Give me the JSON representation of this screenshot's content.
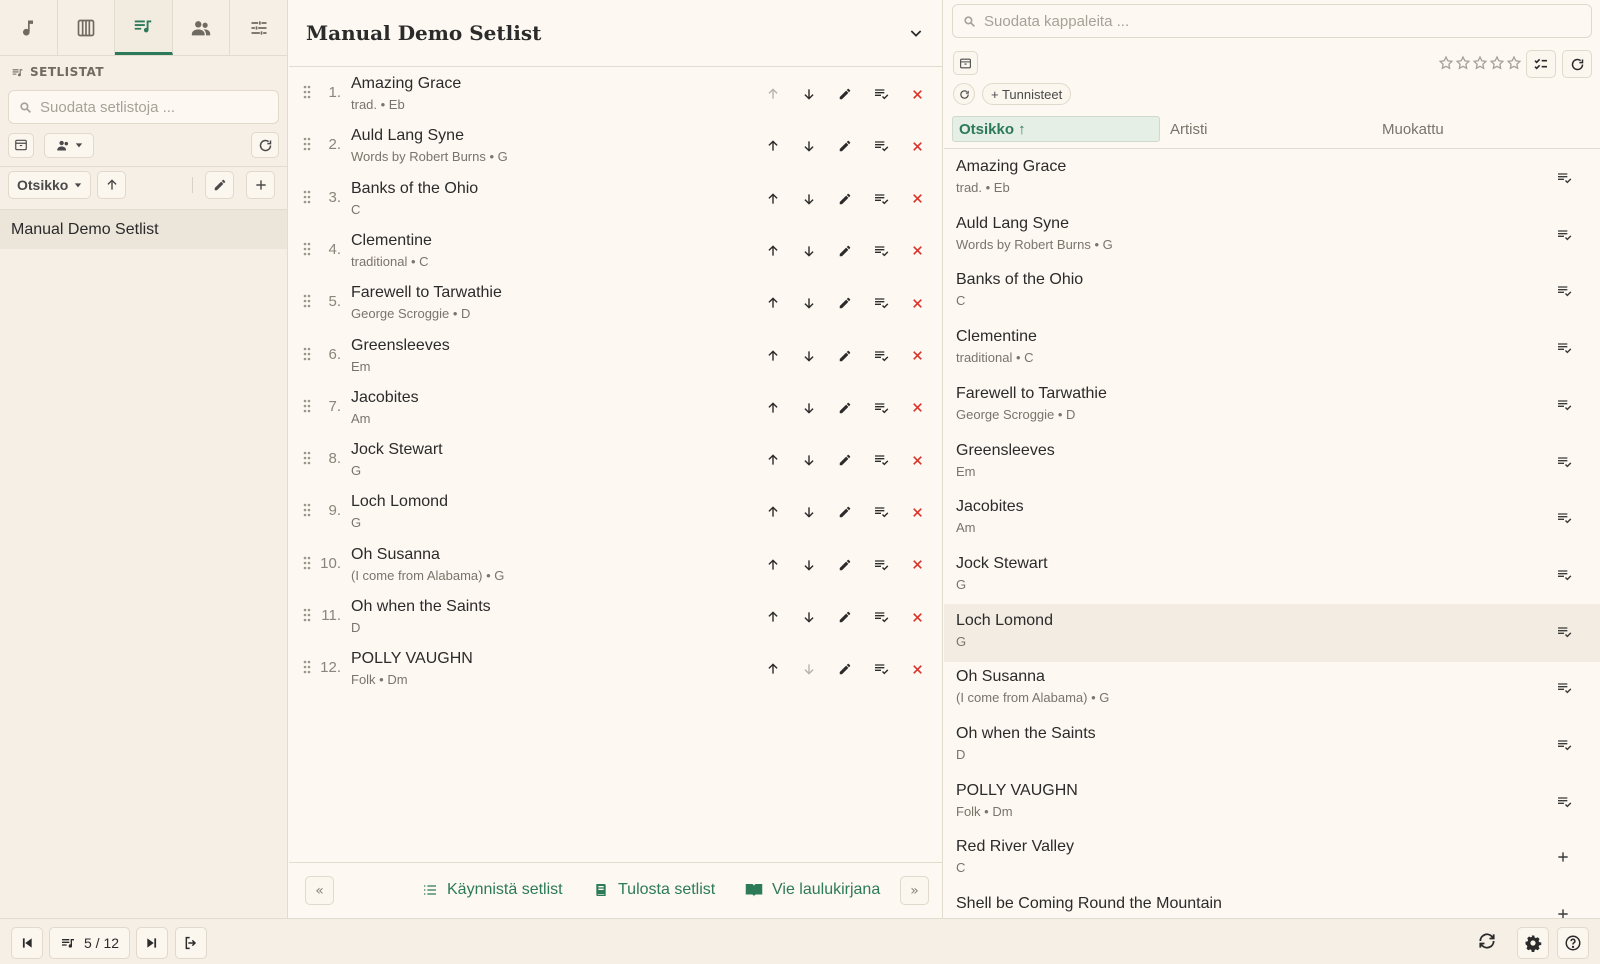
{
  "left": {
    "tabs": [
      "music-note-icon",
      "piano-icon",
      "playlist-icon",
      "people-icon",
      "sliders-icon"
    ],
    "section_title": "SETLISTAT",
    "filter_placeholder": "Suodata setlistoja ...",
    "sort_label": "Otsikko",
    "setlists": [
      "Manual Demo Setlist"
    ]
  },
  "middle": {
    "title": "Manual Demo Setlist",
    "songs": [
      {
        "n": "1.",
        "title": "Amazing Grace",
        "sub": "trad. • Eb",
        "up_disabled": true,
        "down_disabled": false
      },
      {
        "n": "2.",
        "title": "Auld Lang Syne",
        "sub": "Words by Robert Burns • G",
        "up_disabled": false,
        "down_disabled": false
      },
      {
        "n": "3.",
        "title": "Banks of the Ohio",
        "sub": "C",
        "up_disabled": false,
        "down_disabled": false
      },
      {
        "n": "4.",
        "title": "Clementine",
        "sub": "traditional • C",
        "up_disabled": false,
        "down_disabled": false
      },
      {
        "n": "5.",
        "title": "Farewell to Tarwathie",
        "sub": "George Scroggie • D",
        "up_disabled": false,
        "down_disabled": false
      },
      {
        "n": "6.",
        "title": "Greensleeves",
        "sub": "Em",
        "up_disabled": false,
        "down_disabled": false
      },
      {
        "n": "7.",
        "title": "Jacobites",
        "sub": "Am",
        "up_disabled": false,
        "down_disabled": false
      },
      {
        "n": "8.",
        "title": "Jock Stewart",
        "sub": "G",
        "up_disabled": false,
        "down_disabled": false
      },
      {
        "n": "9.",
        "title": "Loch Lomond",
        "sub": "G",
        "up_disabled": false,
        "down_disabled": false
      },
      {
        "n": "10.",
        "title": "Oh Susanna",
        "sub": "(I come from Alabama) • G",
        "up_disabled": false,
        "down_disabled": false
      },
      {
        "n": "11.",
        "title": "Oh when the Saints",
        "sub": "D",
        "up_disabled": false,
        "down_disabled": false
      },
      {
        "n": "12.",
        "title": "POLLY VAUGHN",
        "sub": "Folk • Dm",
        "up_disabled": false,
        "down_disabled": true
      }
    ],
    "footer": {
      "prev": "«",
      "next": "»",
      "start": "Käynnistä setlist",
      "print": "Tulosta setlist",
      "export": "Vie laulukirjana"
    }
  },
  "right": {
    "filter_placeholder": "Suodata kappaleita ...",
    "tags_label": "+ Tunnisteet",
    "columns": [
      "Otsikko ↑",
      "Artisti",
      "Muokattu"
    ],
    "songs": [
      {
        "title": "Amazing Grace",
        "sub": "trad. • Eb",
        "in_setlist": true
      },
      {
        "title": "Auld Lang Syne",
        "sub": "Words by Robert Burns • G",
        "in_setlist": true
      },
      {
        "title": "Banks of the Ohio",
        "sub": "C",
        "in_setlist": true
      },
      {
        "title": "Clementine",
        "sub": "traditional • C",
        "in_setlist": true
      },
      {
        "title": "Farewell to Tarwathie",
        "sub": "George Scroggie • D",
        "in_setlist": true
      },
      {
        "title": "Greensleeves",
        "sub": "Em",
        "in_setlist": true
      },
      {
        "title": "Jacobites",
        "sub": "Am",
        "in_setlist": true
      },
      {
        "title": "Jock Stewart",
        "sub": "G",
        "in_setlist": true
      },
      {
        "title": "Loch Lomond",
        "sub": "G",
        "in_setlist": true,
        "highlight": true
      },
      {
        "title": "Oh Susanna",
        "sub": "(I come from Alabama) • G",
        "in_setlist": true
      },
      {
        "title": "Oh when the Saints",
        "sub": "D",
        "in_setlist": true
      },
      {
        "title": "POLLY VAUGHN",
        "sub": "Folk • Dm",
        "in_setlist": true
      },
      {
        "title": "Red River Valley",
        "sub": "C",
        "in_setlist": false
      },
      {
        "title": "Shell be Coming Round the Mountain",
        "sub": "",
        "in_setlist": false
      }
    ]
  },
  "bottom": {
    "position": "5 / 12"
  },
  "colors": {
    "accent": "#2c7a5a",
    "danger": "#d9342b",
    "background": "#fdf8f1",
    "panel": "#f5efe5"
  }
}
